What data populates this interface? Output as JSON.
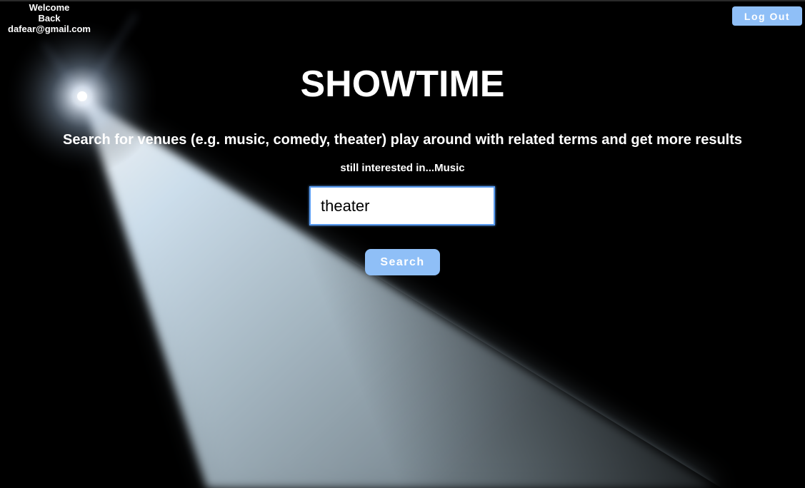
{
  "header": {
    "welcome_line1": "Welcome",
    "welcome_line2": "Back",
    "user_email": "dafear@gmail.com",
    "logout_label": "Log Out"
  },
  "main": {
    "title": "SHOWTIME",
    "subtitle": "Search for venues (e.g. music, comedy, theater) play around with related terms and get more results",
    "interest_text": "still interested in...Music",
    "search_value": "theater",
    "search_label": "Search"
  },
  "colors": {
    "background": "#000000",
    "accent_button": "#8fbff7",
    "input_focus_border": "#5a9cf0",
    "spotlight_beam": "#cfe2f0"
  }
}
